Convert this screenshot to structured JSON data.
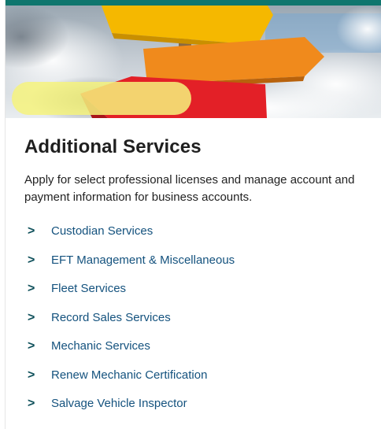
{
  "panel": {
    "title": "Additional Services",
    "description": "Apply for select professional licenses and manage account and payment information for business accounts.",
    "chevron": ">",
    "links": [
      {
        "label": "Custodian Services"
      },
      {
        "label": "EFT Management & Miscellaneous"
      },
      {
        "label": "Fleet Services"
      },
      {
        "label": "Record Sales Services",
        "highlighted": true
      },
      {
        "label": "Mechanic Services"
      },
      {
        "label": "Renew Mechanic Certification"
      },
      {
        "label": "Salvage Vehicle Inspector"
      }
    ]
  },
  "colors": {
    "accent_bar": "#0f766e",
    "link_text": "#14527e",
    "chevron": "#0d4f5a",
    "highlight": "#f6f37c",
    "sign_yellow": "#f5b800",
    "sign_orange": "#f08a1c",
    "sign_red": "#e32027"
  }
}
